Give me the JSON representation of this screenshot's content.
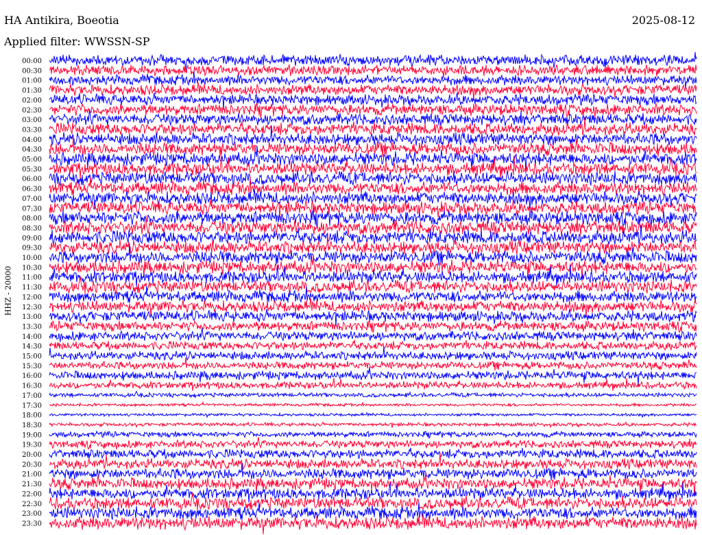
{
  "header": {
    "station": "HA Antikira, Boeotia",
    "date": "2025-08-12",
    "filter_label": "Applied filter: WWSSN-SP"
  },
  "chart_data": {
    "type": "line",
    "title": "HA Antikira, Boeotia",
    "ylabel": "HHZ - 20000",
    "xlabel": "",
    "series_colors": [
      "#0000ff",
      "#ff0033"
    ],
    "rows": [
      {
        "label": "00:00",
        "amplitude": 0.75
      },
      {
        "label": "00:30",
        "amplitude": 0.7
      },
      {
        "label": "01:00",
        "amplitude": 0.7
      },
      {
        "label": "01:30",
        "amplitude": 0.75
      },
      {
        "label": "02:00",
        "amplitude": 0.75
      },
      {
        "label": "02:30",
        "amplitude": 0.8
      },
      {
        "label": "03:00",
        "amplitude": 0.8
      },
      {
        "label": "03:30",
        "amplitude": 0.85
      },
      {
        "label": "04:00",
        "amplitude": 0.85
      },
      {
        "label": "04:30",
        "amplitude": 0.9
      },
      {
        "label": "05:00",
        "amplitude": 0.9
      },
      {
        "label": "05:30",
        "amplitude": 0.9
      },
      {
        "label": "06:00",
        "amplitude": 0.9
      },
      {
        "label": "06:30",
        "amplitude": 0.9
      },
      {
        "label": "07:00",
        "amplitude": 0.9
      },
      {
        "label": "07:30",
        "amplitude": 0.9
      },
      {
        "label": "08:00",
        "amplitude": 0.95
      },
      {
        "label": "08:30",
        "amplitude": 0.95
      },
      {
        "label": "09:00",
        "amplitude": 0.95
      },
      {
        "label": "09:30",
        "amplitude": 0.9
      },
      {
        "label": "10:00",
        "amplitude": 0.9
      },
      {
        "label": "10:30",
        "amplitude": 0.9
      },
      {
        "label": "11:00",
        "amplitude": 0.85
      },
      {
        "label": "11:30",
        "amplitude": 0.85
      },
      {
        "label": "12:00",
        "amplitude": 0.8
      },
      {
        "label": "12:30",
        "amplitude": 0.8
      },
      {
        "label": "13:00",
        "amplitude": 0.75
      },
      {
        "label": "13:30",
        "amplitude": 0.7
      },
      {
        "label": "14:00",
        "amplitude": 0.65
      },
      {
        "label": "14:30",
        "amplitude": 0.6
      },
      {
        "label": "15:00",
        "amplitude": 0.6
      },
      {
        "label": "15:30",
        "amplitude": 0.55
      },
      {
        "label": "16:00",
        "amplitude": 0.6
      },
      {
        "label": "16:30",
        "amplitude": 0.5
      },
      {
        "label": "17:00",
        "amplitude": 0.3
      },
      {
        "label": "17:30",
        "amplitude": 0.2
      },
      {
        "label": "18:00",
        "amplitude": 0.2
      },
      {
        "label": "18:30",
        "amplitude": 0.25
      },
      {
        "label": "19:00",
        "amplitude": 0.4
      },
      {
        "label": "19:30",
        "amplitude": 0.55
      },
      {
        "label": "20:00",
        "amplitude": 0.65
      },
      {
        "label": "20:30",
        "amplitude": 0.7
      },
      {
        "label": "21:00",
        "amplitude": 0.75
      },
      {
        "label": "21:30",
        "amplitude": 0.8
      },
      {
        "label": "22:00",
        "amplitude": 0.8
      },
      {
        "label": "22:30",
        "amplitude": 0.85
      },
      {
        "label": "23:00",
        "amplitude": 0.85
      },
      {
        "label": "23:30",
        "amplitude": 0.9
      }
    ]
  }
}
